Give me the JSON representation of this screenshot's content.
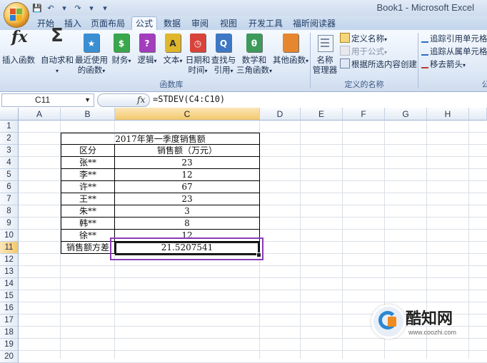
{
  "window": {
    "title": "Book1 - Microsoft Excel"
  },
  "qat": {
    "save": "💾",
    "undo": "↶",
    "redo": "↷",
    "more": "▾"
  },
  "tabs": [
    "开始",
    "插入",
    "页面布局",
    "公式",
    "数据",
    "审阅",
    "视图",
    "开发工具",
    "福昕阅读器"
  ],
  "active_tab": "公式",
  "ribbon": {
    "insert_function": "插入函数",
    "buttons": [
      {
        "line1": "自动求和",
        "line2": "",
        "icon": "sigma-icon",
        "color": "#333333"
      },
      {
        "line1": "最近使用",
        "line2": "的函数",
        "icon": "star-book-icon",
        "color": "#3a8fd3"
      },
      {
        "line1": "财务",
        "line2": "",
        "icon": "finance-book-icon",
        "color": "#3aa64d"
      },
      {
        "line1": "逻辑",
        "line2": "",
        "icon": "logic-book-icon",
        "color": "#a23dbd"
      },
      {
        "line1": "文本",
        "line2": "",
        "icon": "text-book-icon",
        "color": "#e0b62b"
      },
      {
        "line1": "日期和",
        "line2": "时间",
        "icon": "date-book-icon",
        "color": "#d8433a"
      },
      {
        "line1": "查找与",
        "line2": "引用",
        "icon": "lookup-book-icon",
        "color": "#3e78c4"
      },
      {
        "line1": "数学和",
        "line2": "三角函数",
        "icon": "math-book-icon",
        "color": "#3c9a5a"
      },
      {
        "line1": "其他函数",
        "line2": "",
        "icon": "more-book-icon",
        "color": "#e6862f"
      }
    ],
    "book_glyphs": [
      "★",
      "$",
      "?",
      "A",
      "◷",
      "Q",
      "θ",
      ""
    ],
    "group_function_library": "函数库",
    "name_manager_line1": "名称",
    "name_manager_line2": "管理器",
    "define_name": "定义名称",
    "use_in_formula": "用于公式",
    "create_from_selection": "根据所选内容创建",
    "group_defined_names": "定义的名称",
    "trace_precedents": "追踪引用单元格",
    "trace_dependents": "追踪从属单元格",
    "remove_arrows": "移去箭头",
    "group_audit": "公"
  },
  "formula_bar": {
    "name_box": "C11",
    "fx": "fx",
    "formula": "=STDEV(C4:C10)"
  },
  "columns": [
    "A",
    "B",
    "C",
    "D",
    "E",
    "F",
    "G",
    "H"
  ],
  "rows": [
    "1",
    "2",
    "3",
    "4",
    "5",
    "6",
    "7",
    "8",
    "9",
    "10",
    "11",
    "12",
    "13",
    "14",
    "15",
    "16",
    "17",
    "18",
    "19",
    "20"
  ],
  "table": {
    "title": "2017年第一季度销售额",
    "header": [
      "区分",
      "销售额（万元）"
    ],
    "rows": [
      [
        "张**",
        "23"
      ],
      [
        "李**",
        "12"
      ],
      [
        "许**",
        "67"
      ],
      [
        "王**",
        "23"
      ],
      [
        "朱**",
        "3"
      ],
      [
        "韩**",
        "8"
      ],
      [
        "徐**",
        "12"
      ]
    ],
    "result_label": "销售额方差",
    "result_value": "21.5207541"
  },
  "watermark": {
    "brand": "酷知网",
    "url": "www.coozhi.com"
  },
  "colors": {
    "highlight_box": "#8a3bb5",
    "selected_header": "#f3c86a",
    "ribbon_bg": "#dde8f6"
  }
}
